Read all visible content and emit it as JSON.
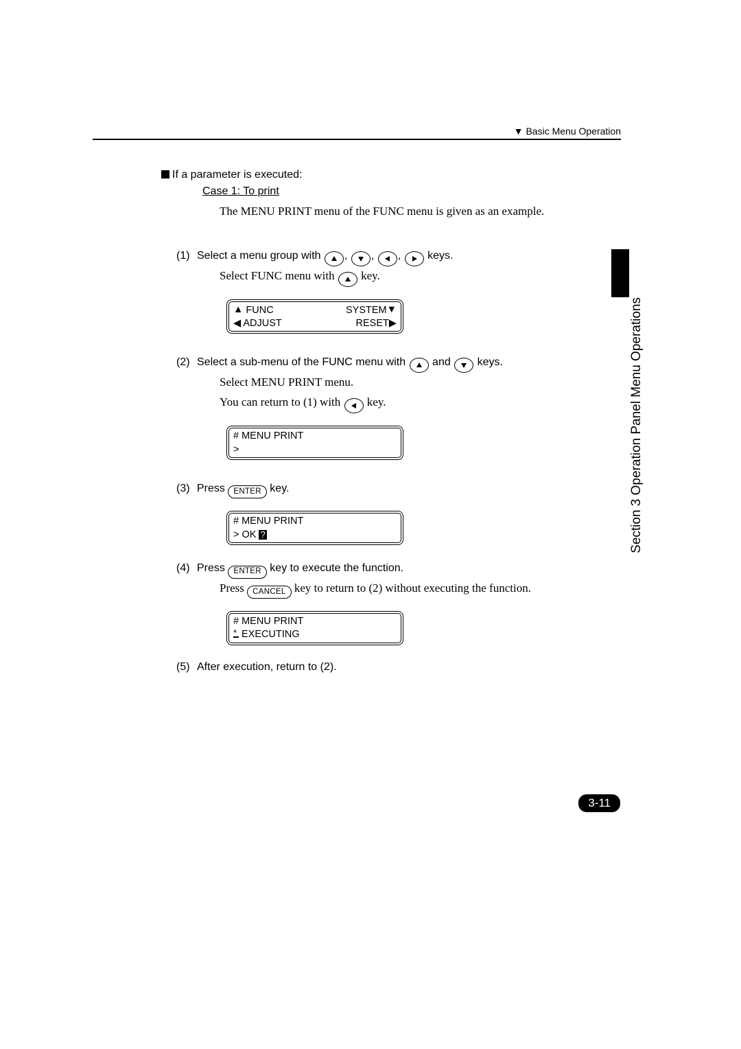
{
  "header": {
    "marker": "▼",
    "text": "Basic Menu Operation"
  },
  "intro": {
    "heading": "If a parameter is executed:",
    "case": "Case 1: To print",
    "example": "The MENU PRINT menu of the FUNC menu is given as an example."
  },
  "steps": {
    "s1": {
      "num": "(1)",
      "text_a": "Select a menu group with",
      "text_b": "keys.",
      "sub_a": "Select FUNC menu with",
      "sub_b": "key."
    },
    "s2": {
      "num": "(2)",
      "text_a": "Select a sub-menu of the FUNC menu with",
      "text_mid": "and",
      "text_b": "keys.",
      "sub_a": "Select MENU PRINT menu.",
      "sub_b_a": "You can return to (1) with",
      "sub_b_b": "key."
    },
    "s3": {
      "num": "(3)",
      "text_a": "Press",
      "text_b": "key."
    },
    "s4": {
      "num": "(4)",
      "text_a": "Press",
      "text_b": "key to execute the function.",
      "sub_a": "Press",
      "sub_b": "key to return to (2) without executing the function."
    },
    "s5": {
      "num": "(5)",
      "text": "After execution, return to (2)."
    }
  },
  "buttons": {
    "enter": "ENTER",
    "cancel": "CANCEL"
  },
  "lcd": {
    "d1": {
      "tl": "FUNC",
      "tr": "SYSTEM",
      "bl": "ADJUST",
      "br": "RESET"
    },
    "d2": {
      "l1": "# MENU PRINT",
      "l2": ">"
    },
    "d3": {
      "l1": "# MENU PRINT",
      "l2a": "> OK",
      "l2b": "?"
    },
    "d4": {
      "l1": "# MENU PRINT",
      "l2": " EXECUTING"
    }
  },
  "side": {
    "label": "Section 3  Operation Panel Menu Operations"
  },
  "page_num": "3-11"
}
